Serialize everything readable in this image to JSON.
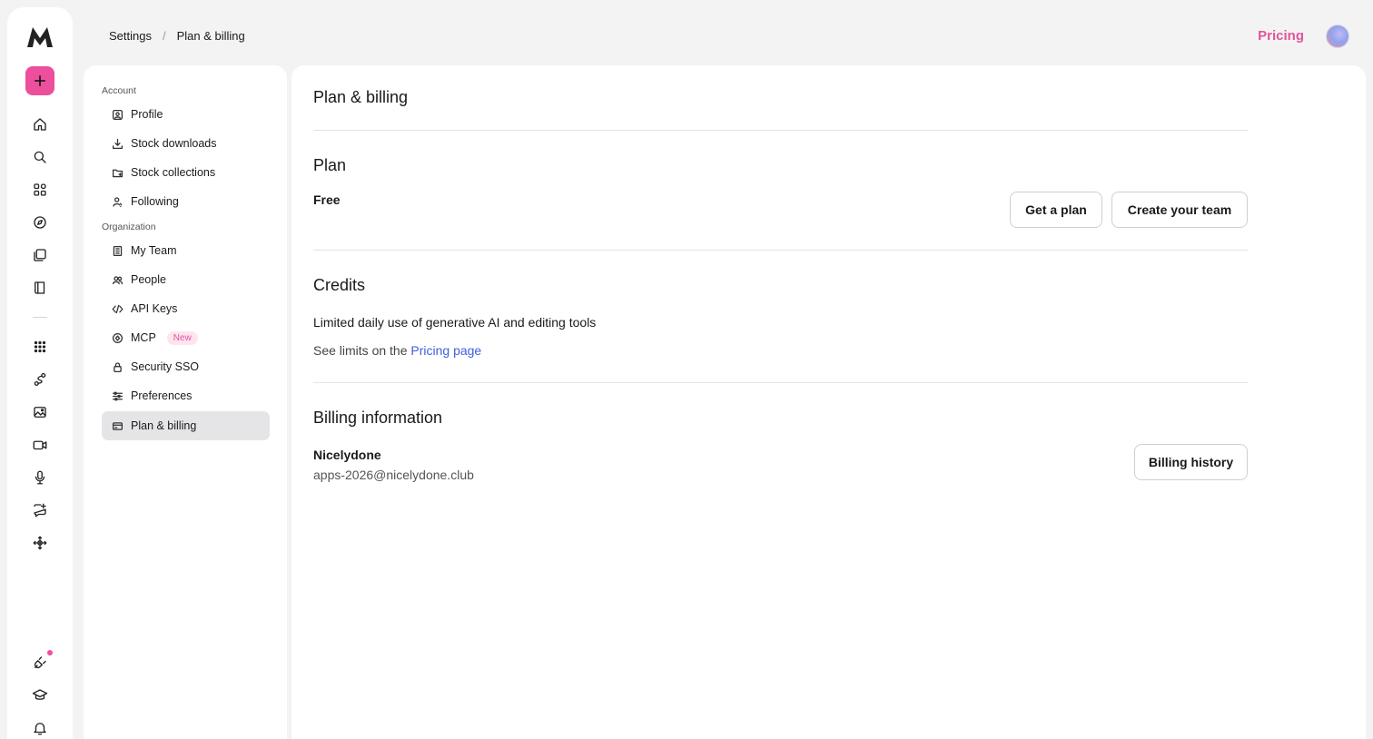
{
  "breadcrumb": {
    "root": "Settings",
    "separator": "/",
    "current": "Plan & billing"
  },
  "header": {
    "pricing_label": "Pricing"
  },
  "rail": {
    "icons": [
      "logo-icon",
      "plus-icon",
      "home-icon",
      "search-icon",
      "apps-grid-icon",
      "compass-icon",
      "collections-icon",
      "book-icon",
      "dots-grid-icon",
      "route-icon",
      "image-icon",
      "video-icon",
      "microphone-icon",
      "chat-sparkle-icon",
      "move-icon",
      "plug-icon",
      "graduation-cap-icon",
      "bell-icon"
    ],
    "accent_color": "#ec4f9b"
  },
  "nav": {
    "account_title": "Account",
    "organization_title": "Organization",
    "account_items": [
      {
        "label": "Profile",
        "icon": "profile-icon"
      },
      {
        "label": "Stock downloads",
        "icon": "download-icon"
      },
      {
        "label": "Stock collections",
        "icon": "folder-icon"
      },
      {
        "label": "Following",
        "icon": "following-icon"
      }
    ],
    "organization_items": [
      {
        "label": "My Team",
        "icon": "building-icon"
      },
      {
        "label": "People",
        "icon": "people-icon"
      },
      {
        "label": "API Keys",
        "icon": "code-icon"
      },
      {
        "label": "MCP",
        "icon": "mcp-icon",
        "badge": "New"
      },
      {
        "label": "Security SSO",
        "icon": "lock-icon"
      },
      {
        "label": "Preferences",
        "icon": "sliders-icon"
      },
      {
        "label": "Plan & billing",
        "icon": "card-icon",
        "active": true
      }
    ]
  },
  "main": {
    "title": "Plan & billing",
    "plan": {
      "heading": "Plan",
      "name": "Free",
      "get_plan_label": "Get a plan",
      "create_team_label": "Create your team"
    },
    "credits": {
      "heading": "Credits",
      "description": "Limited daily use of generative AI and editing tools",
      "limits_prefix": "See limits on the",
      "limits_link": "Pricing page"
    },
    "billing": {
      "heading": "Billing information",
      "name": "Nicelydone",
      "email": "apps-2026@nicelydone.club",
      "history_label": "Billing history"
    }
  }
}
